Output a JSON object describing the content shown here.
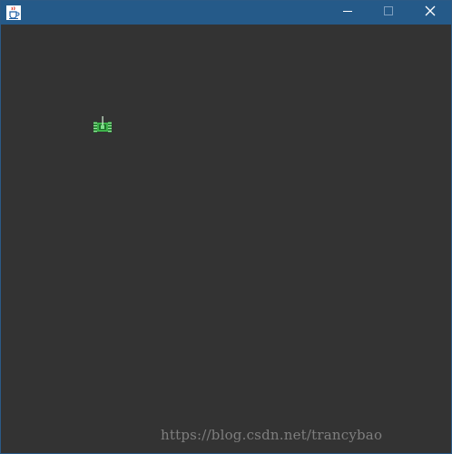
{
  "window": {
    "title": "",
    "icons": {
      "app": "java-coffee-cup-icon",
      "minimize": "minimize-icon",
      "maximize": "maximize-icon",
      "close": "close-icon"
    },
    "colors": {
      "titlebar": "#255a89",
      "canvas": "#333333",
      "border": "#2b5a86"
    }
  },
  "canvas": {
    "sprites": [
      {
        "name": "player-tank",
        "icon": "green-tank-icon",
        "color": "#3db34a"
      }
    ],
    "watermark": "https://blog.csdn.net/trancybao"
  }
}
